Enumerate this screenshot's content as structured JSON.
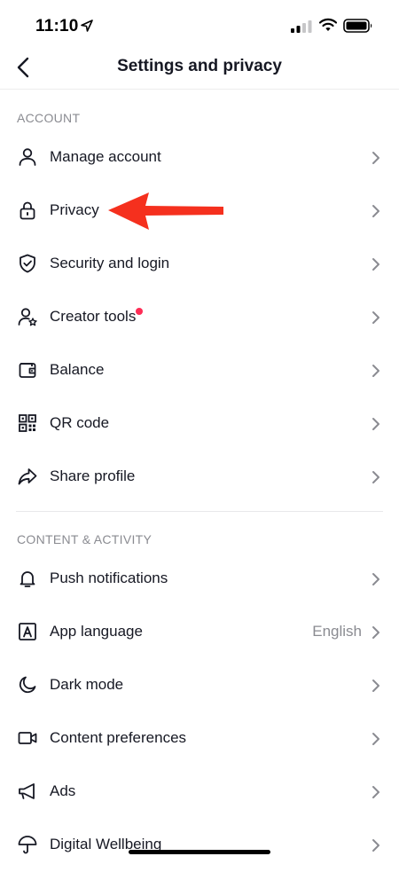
{
  "status_bar": {
    "time": "11:10"
  },
  "nav": {
    "title": "Settings and privacy",
    "back_icon": "chevron-left-icon"
  },
  "sections": {
    "account": {
      "header": "ACCOUNT",
      "items": [
        {
          "label": "Manage account",
          "icon": "person-icon"
        },
        {
          "label": "Privacy",
          "icon": "lock-icon"
        },
        {
          "label": "Security and login",
          "icon": "shield-check-icon"
        },
        {
          "label": "Creator tools",
          "icon": "person-star-icon",
          "badge": true
        },
        {
          "label": "Balance",
          "icon": "wallet-icon"
        },
        {
          "label": "QR code",
          "icon": "qr-code-icon"
        },
        {
          "label": "Share profile",
          "icon": "share-arrow-icon"
        }
      ]
    },
    "content_activity": {
      "header": "CONTENT & ACTIVITY",
      "items": [
        {
          "label": "Push notifications",
          "icon": "bell-icon"
        },
        {
          "label": "App language",
          "icon": "language-a-icon",
          "value": "English"
        },
        {
          "label": "Dark mode",
          "icon": "moon-icon"
        },
        {
          "label": "Content preferences",
          "icon": "video-camera-icon"
        },
        {
          "label": "Ads",
          "icon": "megaphone-icon"
        },
        {
          "label": "Digital Wellbeing",
          "icon": "umbrella-icon"
        }
      ]
    }
  },
  "colors": {
    "accent_badge": "#fe2c55",
    "annotation_arrow": "#f5301e",
    "text_primary": "#161823",
    "text_secondary": "#8a8b91"
  }
}
